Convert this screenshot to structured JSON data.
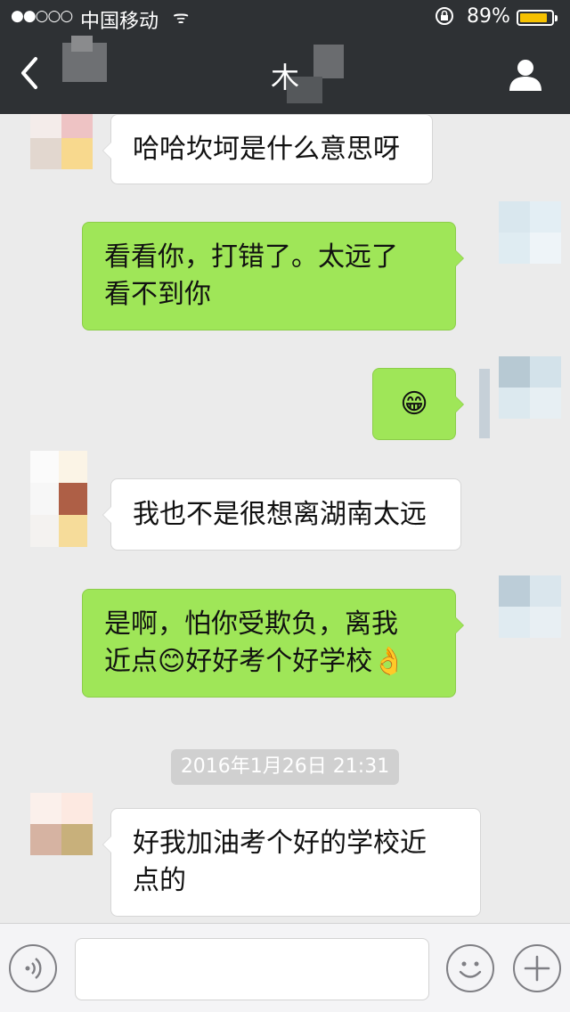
{
  "status_bar": {
    "signal": "●●○○○",
    "carrier": "中国移动",
    "wifi": "ᯤ",
    "battery_percent": "89%",
    "battery_level": 0.89,
    "battery_color": "#f6c100"
  },
  "navbar": {
    "back_icon": "chevron-left-icon",
    "title": "木",
    "profile_icon": "person-icon"
  },
  "messages": [
    {
      "side": "in",
      "text": "哈哈坎坷是什么意思呀"
    },
    {
      "side": "out",
      "text": "看看你，打错了。太远了\n看不到你"
    },
    {
      "side": "out",
      "emoji": "😁"
    },
    {
      "side": "in",
      "text": "我也不是很想离湖南太远"
    },
    {
      "side": "out",
      "text_a": "是啊，怕你受欺负，离我",
      "text_b": "近点",
      "emoji_a": "😊",
      "text_c": "好好考个好学校",
      "emoji_b": "👌"
    },
    {
      "side": "in",
      "text": "好我加油考个好的学校近\n点的"
    }
  ],
  "timestamp": "2016年1月26日 21:31",
  "input_bar": {
    "voice_icon": "voice-icon",
    "emoji_icon": "emoji-icon",
    "plus_icon": "plus-icon",
    "input_value": ""
  },
  "colors": {
    "navbar_bg": "#2e3134",
    "chat_bg": "#ebebeb",
    "bubble_out": "#9fe658",
    "bubble_in": "#ffffff"
  }
}
